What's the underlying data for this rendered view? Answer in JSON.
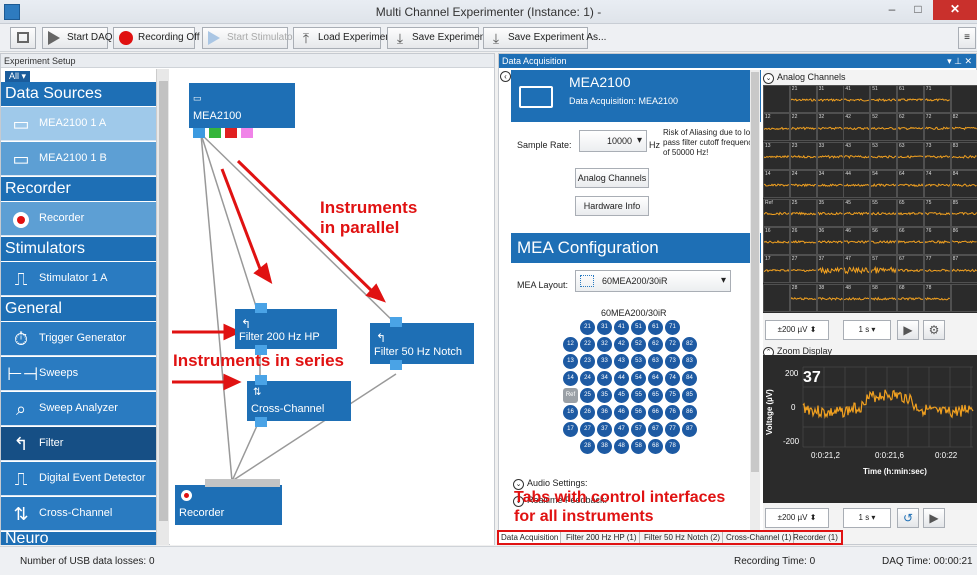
{
  "window": {
    "title": "Multi Channel Experimenter (Instance: 1) -",
    "min": "–",
    "max": "□",
    "close": "✕"
  },
  "toolbar": {
    "start_daq": "Start DAQ",
    "recording": "Recording Off",
    "start_stimulator": "Start Stimulator",
    "load": "Load Experiment",
    "save": "Save Experiment",
    "save_as": "Save Experiment As..."
  },
  "left_panel": {
    "title": "Experiment Setup",
    "filter": "All"
  },
  "palette": {
    "categories": [
      "Data Sources",
      "Recorder",
      "Stimulators",
      "General",
      "Neuro"
    ],
    "items": [
      {
        "label": "MEA2100   1   A"
      },
      {
        "label": "MEA2100   1   B"
      },
      {
        "label": "Recorder"
      },
      {
        "label": "Stimulator   1   A"
      },
      {
        "label": "Trigger Generator"
      },
      {
        "label": "Sweeps"
      },
      {
        "label": "Sweep Analyzer"
      },
      {
        "label": "Filter"
      },
      {
        "label": "Digital Event Detector"
      },
      {
        "label": "Cross-Channel"
      }
    ]
  },
  "nodes": {
    "source": "MEA2100",
    "filter_hp": "Filter 200 Hz HP",
    "filter_notch": "Filter 50 Hz Notch",
    "cross_channel": "Cross-Channel",
    "recorder": "Recorder"
  },
  "annotations": {
    "parallel": "Instruments\nin parallel",
    "series": "Instruments in series",
    "tabs": "Tabs with control interfaces\nfor all instruments"
  },
  "daq": {
    "header": "Data Acquisition",
    "device": "MEA2100",
    "device_sub": "Data Acquisition:  MEA2100",
    "sample_rate_label": "Sample Rate:",
    "sample_rate": "10000",
    "hz": "Hz",
    "warning": "Risk of Aliasing due to low pass filter cutoff frequency of 50000 Hz!",
    "analog_channels_btn": "Analog Channels",
    "hardware_info_btn": "Hardware Info",
    "mea_config": "MEA Configuration",
    "layout_label": "MEA Layout:",
    "layout_value": "60MEA200/30iR",
    "layout_caption": "60MEA200/30iR",
    "audio_settings": "Audio Settings:",
    "realtime_feedback": "Realtime Feedback:",
    "electrode_rows": [
      [
        "21",
        "31",
        "41",
        "51",
        "61",
        "71"
      ],
      [
        "12",
        "22",
        "32",
        "42",
        "52",
        "62",
        "72",
        "82"
      ],
      [
        "13",
        "23",
        "33",
        "43",
        "53",
        "63",
        "73",
        "83"
      ],
      [
        "14",
        "24",
        "34",
        "44",
        "54",
        "64",
        "74",
        "84"
      ],
      [
        "Ref",
        "25",
        "35",
        "45",
        "55",
        "65",
        "75",
        "85"
      ],
      [
        "16",
        "26",
        "36",
        "46",
        "56",
        "66",
        "76",
        "86"
      ],
      [
        "17",
        "27",
        "37",
        "47",
        "57",
        "67",
        "77",
        "87"
      ],
      [
        "28",
        "38",
        "48",
        "58",
        "68",
        "78"
      ]
    ]
  },
  "analog": {
    "header": "Analog Channels",
    "grid_rows": [
      [
        "",
        "21",
        "31",
        "41",
        "51",
        "61",
        "71",
        ""
      ],
      [
        "12",
        "22",
        "32",
        "42",
        "52",
        "62",
        "72",
        "82"
      ],
      [
        "13",
        "23",
        "33",
        "43",
        "53",
        "63",
        "73",
        "83"
      ],
      [
        "14",
        "24",
        "34",
        "44",
        "54",
        "64",
        "74",
        "84"
      ],
      [
        "Ref",
        "25",
        "35",
        "45",
        "55",
        "65",
        "75",
        "85"
      ],
      [
        "16",
        "26",
        "36",
        "46",
        "56",
        "66",
        "76",
        "86"
      ],
      [
        "17",
        "27",
        "37",
        "47",
        "57",
        "67",
        "77",
        "87"
      ],
      [
        "",
        "28",
        "38",
        "48",
        "58",
        "68",
        "78",
        ""
      ]
    ],
    "amp": "±200 µV",
    "time": "1 s"
  },
  "zoom": {
    "header": "Zoom Display",
    "channel": "37",
    "ylabel": "Voltage (µV)",
    "xlabel": "Time (h:min:sec)",
    "y_ticks": [
      "200",
      "0",
      "-200"
    ],
    "x_ticks": [
      "0:0:21,2",
      "0:0:21,6",
      "0:0:22"
    ],
    "amp": "±200 µV",
    "time": "1 s"
  },
  "tabs": [
    "Data Acquisition",
    "Filter 200 Hz HP (1)",
    "Filter 50 Hz Notch (2)",
    "Cross-Channel (1)",
    "Recorder (1)"
  ],
  "status": {
    "usb": "Number of USB data losses:  0",
    "recording_time": "Recording Time:  0",
    "daq_time": "DAQ Time:  00:00:21"
  },
  "colors": {
    "accent": "#1e6fb5",
    "annotation": "#e01212",
    "trace": "#f0a020"
  }
}
